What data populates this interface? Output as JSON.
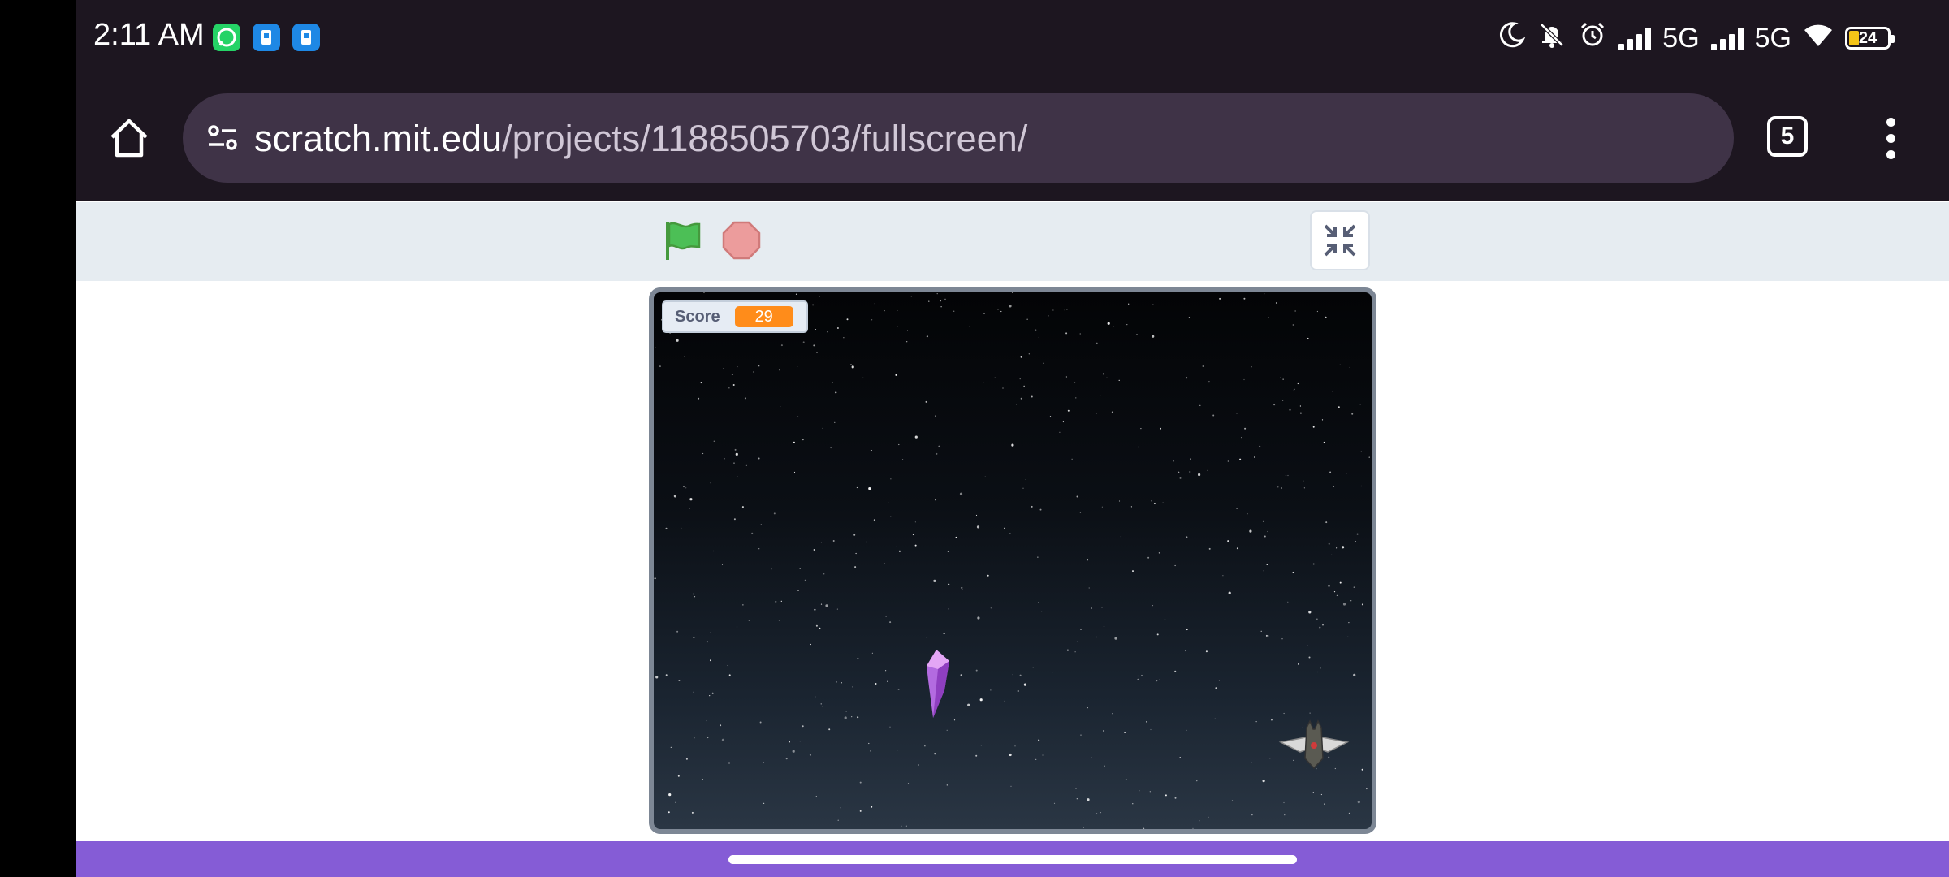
{
  "status_bar": {
    "time": "2:11 AM",
    "network_1": "5G",
    "network_2": "5G",
    "battery_level": "24",
    "notification_icons": [
      "whatsapp-icon",
      "app-icon",
      "app-icon"
    ]
  },
  "browser": {
    "url_domain": "scratch.mit.edu",
    "url_path": "/projects/1188505703/fullscreen/",
    "tab_count": "5"
  },
  "scratch": {
    "score_label": "Score",
    "score_value": "29",
    "colors": {
      "controls_bg": "#e6ecf1",
      "monitor_value": "#ff8c1a",
      "bottom_bar": "#855cd6",
      "flag": "#4cbf56",
      "stop": "#ec9c9c"
    }
  }
}
